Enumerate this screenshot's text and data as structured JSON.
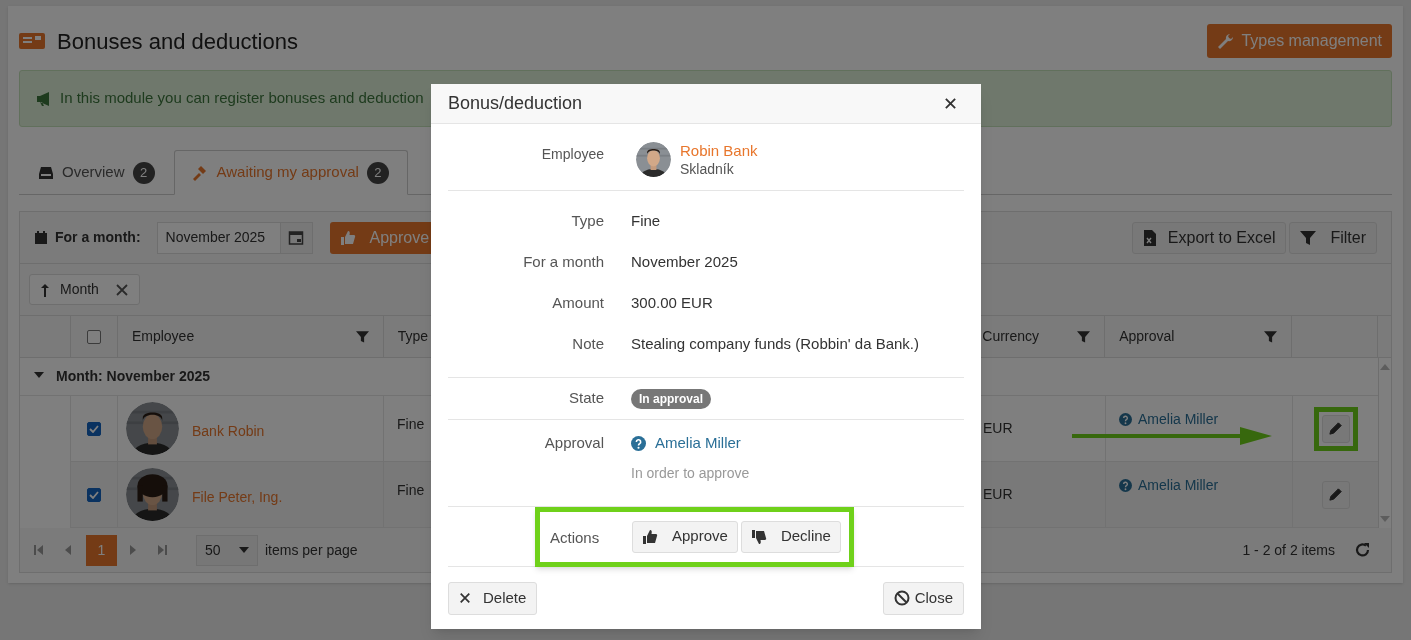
{
  "header": {
    "title": "Bonuses and deductions",
    "types_button": "Types management"
  },
  "info_banner": "In this module you can register bonuses and deduction",
  "tabs": [
    {
      "label": "Overview",
      "count": "2",
      "selected": false
    },
    {
      "label": "Awaiting my approval",
      "count": "2",
      "selected": true
    }
  ],
  "toolbar": {
    "month_label": "For a month:",
    "month_value": "November 2025",
    "approve_button": "Approve",
    "export_button": "Export to Excel",
    "filter_button": "Filter"
  },
  "group_chips": [
    {
      "label": "Month"
    }
  ],
  "table": {
    "columns": [
      "Employee",
      "Type",
      "Currency",
      "Approval"
    ],
    "select_all_checked": false,
    "group": {
      "label": "Month: November 2025",
      "expanded": true
    },
    "rows": [
      {
        "checked": true,
        "employee": "Bank Robin",
        "type": "Fine",
        "currency": "EUR",
        "approval": "Amelia Miller",
        "highlighted": true
      },
      {
        "checked": true,
        "employee": "File Peter, Ing.",
        "type": "Fine",
        "currency": "EUR",
        "approval": "Amelia Miller",
        "highlighted": false
      }
    ]
  },
  "pager": {
    "pages": [
      {
        "label": "1",
        "selected": true
      }
    ],
    "page_size": "50",
    "page_size_label": "items per page",
    "summary": "1 - 2 of 2 items"
  },
  "modal": {
    "title": "Bonus/deduction",
    "employee": {
      "label": "Employee",
      "name": "Robin Bank",
      "position": "Skladník"
    },
    "fields": [
      {
        "label": "Type",
        "value": "Fine"
      },
      {
        "label": "For a month",
        "value": "November 2025"
      },
      {
        "label": "Amount",
        "value": "300.00 EUR"
      },
      {
        "label": "Note",
        "value": "Stealing company funds (Robbin' da Bank.)"
      }
    ],
    "state": {
      "label": "State",
      "badge": "In approval"
    },
    "approval": {
      "label": "Approval",
      "approver": "Amelia Miller",
      "note": "In order to approve"
    },
    "actions": {
      "label": "Actions",
      "buttons": [
        "Approve",
        "Decline"
      ],
      "highlighted": true
    },
    "delete_button": "Delete",
    "close_button": "Close"
  }
}
